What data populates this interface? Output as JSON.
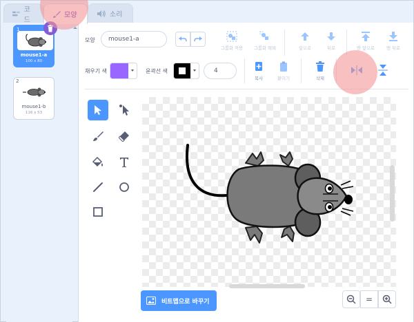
{
  "tabs": [
    {
      "label": "코드",
      "icon": "code-icon"
    },
    {
      "label": "모양",
      "icon": "brush-icon"
    },
    {
      "label": "소리",
      "icon": "speaker-icon"
    }
  ],
  "costumes": [
    {
      "number": "1",
      "name": "mouse1-a",
      "size": "100 x 80"
    },
    {
      "number": "2",
      "name": "mouse1-b",
      "size": "116 x 53"
    }
  ],
  "editor": {
    "costume_label": "모양",
    "costume_name": "mouse1-a",
    "fill_label": "채우기 색",
    "stroke_label": "윤곽선 색",
    "stroke_width": "4",
    "group_label": "그룹화 적용",
    "ungroup_label": "그룹화 해제",
    "forward_label": "앞으로",
    "backward_label": "뒤로",
    "front_label": "맨 앞으로",
    "back_label": "맨 뒤로",
    "copy_label": "복사",
    "paste_label": "붙이기",
    "delete_label": "삭제",
    "convert_button": "비트맵으로 바꾸기",
    "zoom_reset": "="
  },
  "colors": {
    "accent": "#855cd6",
    "primary": "#4c97ff",
    "fill_swatch": "#9966ff",
    "highlight": "#f49696"
  }
}
